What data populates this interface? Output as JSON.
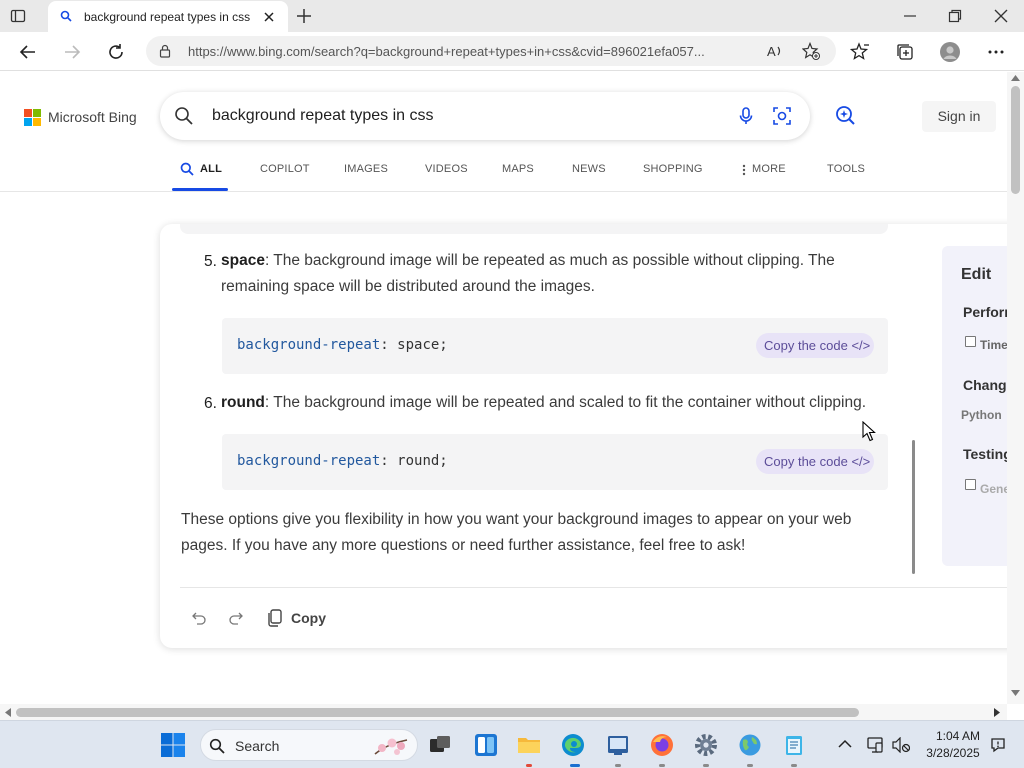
{
  "browser": {
    "tab_title": "background repeat types in css - Search",
    "url": "https://www.bing.com/search?q=background+repeat+types+in+css&cvid=896021efa057..."
  },
  "bing": {
    "logo_text": "Microsoft Bing",
    "search_query": "background repeat types in css",
    "sign_in": "Sign in",
    "scopes": [
      "ALL",
      "COPILOT",
      "IMAGES",
      "VIDEOS",
      "MAPS",
      "NEWS",
      "SHOPPING",
      "MORE",
      "TOOLS"
    ]
  },
  "answer": {
    "items": [
      {
        "num": "5.",
        "keyword": "space",
        "text": ": The background image will be repeated as much as possible without clipping. The remaining space will be distributed around the images.",
        "code_prop": "background-repeat",
        "code_value": ": space;"
      },
      {
        "num": "6.",
        "keyword": "round",
        "text": ": The background image will be repeated and scaled to fit the container without clipping.",
        "code_prop": "background-repeat",
        "code_value": ": round;"
      }
    ],
    "copy_code_label": "Copy the code </>",
    "closing": "These options give you flexibility in how you want your background images to appear on your web pages. If you have any more questions or need further assistance, feel free to ask!",
    "copy_label": "Copy"
  },
  "side_panel": {
    "title": "Edit",
    "performance_heading": "Perforn",
    "performance_checkbox": "Time",
    "change_heading": "Change",
    "change_value": "Python",
    "testing_heading": "Testing",
    "testing_checkbox": "Gene"
  },
  "taskbar": {
    "search_label": "Search",
    "time": "1:04 AM",
    "date": "3/28/2025"
  },
  "colors": {
    "bing_blue": "#174ae4",
    "copilot_purple": "#5c4d99",
    "copy_code_bg": "#e8e3f7"
  }
}
